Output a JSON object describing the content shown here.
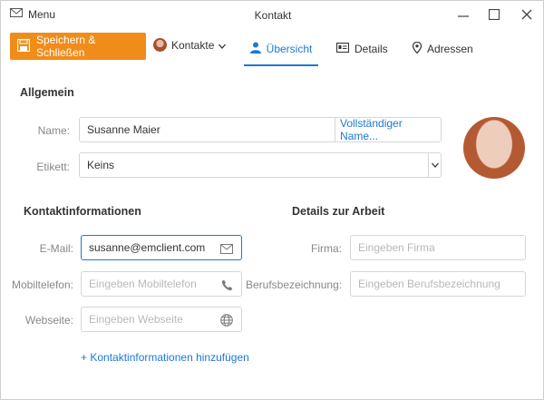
{
  "window": {
    "menu_label": "Menu",
    "title": "Kontakt"
  },
  "toolbar": {
    "save_label": "Speichern & Schließen",
    "contacts_label": "Kontakte",
    "tabs": [
      {
        "label": "Übersicht",
        "icon": "person-icon",
        "active": true
      },
      {
        "label": "Details",
        "icon": "id-card-icon",
        "active": false
      },
      {
        "label": "Adressen",
        "icon": "location-pin-icon",
        "active": false
      }
    ]
  },
  "general": {
    "heading": "Allgemein",
    "name_label": "Name:",
    "name_value": "Susanne Maier",
    "fullname_button": "Vollständiger Name...",
    "tag_label": "Etikett:",
    "tag_value": "Keins"
  },
  "contact_info": {
    "heading": "Kontaktinformationen",
    "email_label": "E-Mail:",
    "email_value": "susanne@emclient.com",
    "mobile_label": "Mobiltelefon:",
    "mobile_placeholder": "Eingeben Mobiltelefon",
    "website_label": "Webseite:",
    "website_placeholder": "Eingeben Webseite",
    "add_link": "+ Kontaktinformationen hinzufügen"
  },
  "work": {
    "heading": "Details zur Arbeit",
    "company_label": "Firma:",
    "company_placeholder": "Eingeben Firma",
    "jobtitle_label": "Berufsbezeichnung:",
    "jobtitle_placeholder": "Eingeben Berufsbezeichnung"
  },
  "colors": {
    "accent": "#1e78d2",
    "save_button": "#f08c1a"
  }
}
